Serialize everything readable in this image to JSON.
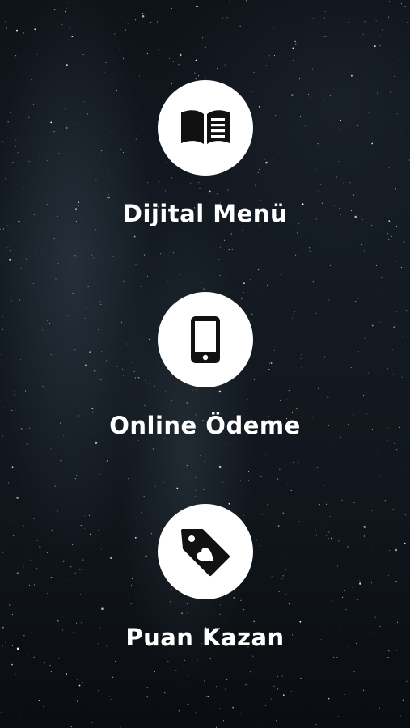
{
  "background": "starry-night-sky",
  "items": [
    {
      "label": "Dijital Menü",
      "icon": "book-open-icon"
    },
    {
      "label": "Online Ödeme",
      "icon": "mobile-phone-icon"
    },
    {
      "label": "Puan Kazan",
      "icon": "heart-tag-icon"
    }
  ]
}
